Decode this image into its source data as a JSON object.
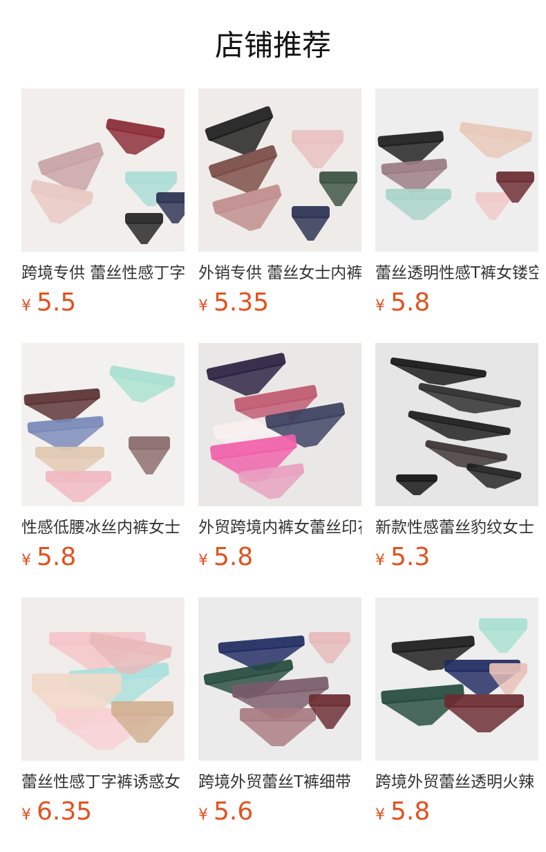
{
  "header": {
    "title": "店铺推荐"
  },
  "currency_symbol": "¥",
  "products": [
    {
      "name": "跨境专供 蕾丝性感丁字裤",
      "price": "5.5",
      "bg": "#f1eeec",
      "colors": [
        "#c8a2a4",
        "#8a2a34",
        "#e8c8c2",
        "#a8dcd4",
        "#222222",
        "#2a3050"
      ]
    },
    {
      "name": "外销专供 蕾丝女士内裤",
      "price": "5.35",
      "bg": "#efebe8",
      "colors": [
        "#1c1c1c",
        "#7a4a44",
        "#c08c8c",
        "#e8c0c0",
        "#2a3050",
        "#3a5040"
      ]
    },
    {
      "name": "蕾丝透明性感T裤女镂空",
      "price": "5.8",
      "bg": "#eeeeee",
      "colors": [
        "#1c1c1c",
        "#9a7a82",
        "#a8d4c8",
        "#e8c8b8",
        "#f0c8c8",
        "#6a2a30"
      ]
    },
    {
      "name": "性感低腰冰丝内裤女士",
      "price": "5.8",
      "bg": "#f3f1ef",
      "colors": [
        "#5a3032",
        "#7888b8",
        "#e0c8b0",
        "#f0b8c0",
        "#a8e0d0",
        "#8a6a6a"
      ]
    },
    {
      "name": "外贸跨境内裤女蕾丝印花",
      "price": "5.8",
      "bg": "#eae8e6",
      "colors": [
        "#2a2040",
        "#c05870",
        "#f8f0f0",
        "#3a4060",
        "#f060a8",
        "#e8a0c0"
      ]
    },
    {
      "name": "新款性感蕾丝豹纹女士",
      "price": "5.3",
      "bg": "#e6e6e6",
      "colors": [
        "#151515",
        "#2a2a2a",
        "#1a1a1a",
        "#3a3030",
        "#202020",
        "#101010"
      ]
    },
    {
      "name": "蕾丝性感丁字裤诱惑女",
      "price": "6.35",
      "bg": "#f0ecea",
      "colors": [
        "#f4c4c8",
        "#a8e0dc",
        "#f0d8c8",
        "#f8d0d4",
        "#e8b8b8",
        "#d0b090"
      ]
    },
    {
      "name": "跨境外贸蕾丝T裤细带",
      "price": "5.6",
      "bg": "#ebebeb",
      "colors": [
        "#1e2a60",
        "#244a3e",
        "#7a5a6a",
        "#a87a80",
        "#e8b8b8",
        "#6a2a30"
      ]
    },
    {
      "name": "跨境外贸蕾丝透明火辣",
      "price": "5.8",
      "bg": "#eeeeee",
      "colors": [
        "#1a1a1a",
        "#1e2a60",
        "#244a3e",
        "#6a2a30",
        "#a8e0d0",
        "#e8c0b8"
      ]
    }
  ]
}
